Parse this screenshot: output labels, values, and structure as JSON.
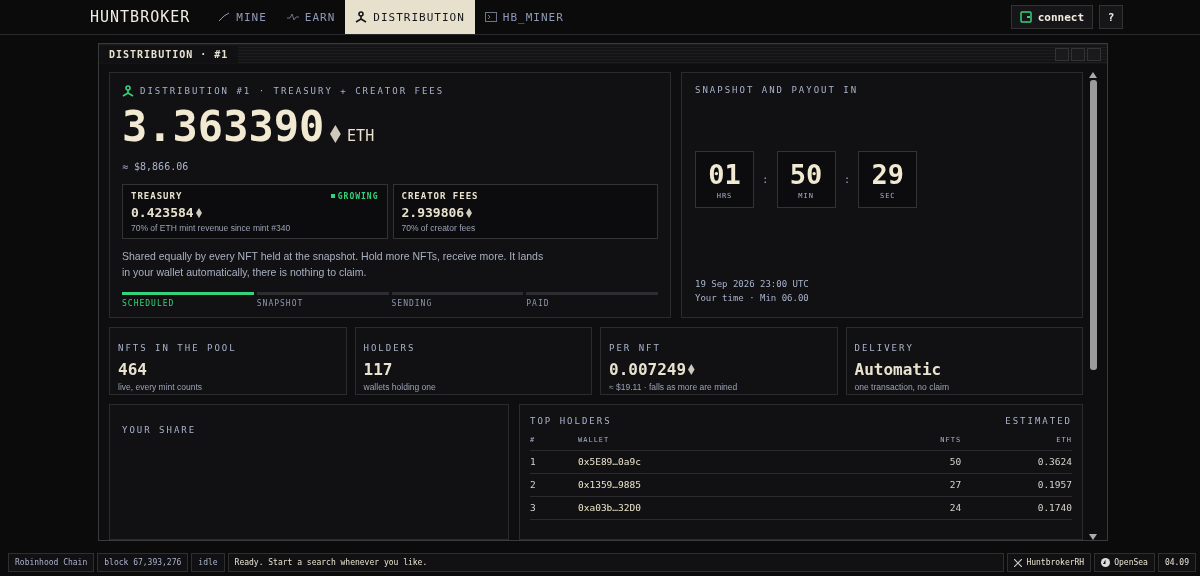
{
  "app": {
    "brand": "HUNTBROKER",
    "tabs": [
      {
        "label": "MINE",
        "selected": false
      },
      {
        "label": "EARN",
        "selected": false
      },
      {
        "label": "DISTRIBUTION",
        "selected": true
      },
      {
        "label": "HB_MINER",
        "selected": false
      }
    ],
    "connect": "connect",
    "help": "?"
  },
  "window": {
    "title": "DISTRIBUTION · #1"
  },
  "pool": {
    "heading": "DISTRIBUTION #1 · TREASURY + CREATOR FEES",
    "amount": "3.363390",
    "unit": "ETH",
    "usd": "≈ $8,866.06",
    "sources": [
      {
        "title": "TREASURY",
        "badge": "GROWING",
        "value": "0.423584",
        "note": "70% of ETH mint revenue since mint #340"
      },
      {
        "title": "CREATOR FEES",
        "value": "2.939806",
        "note": "70% of creator fees"
      }
    ],
    "description": "Shared equally by every NFT held at the snapshot. Hold more NFTs, receive more. It lands in your wallet automatically, there is nothing to claim.",
    "steps": [
      {
        "label": "SCHEDULED",
        "selected": true
      },
      {
        "label": "SNAPSHOT",
        "selected": false
      },
      {
        "label": "SENDING",
        "selected": false
      },
      {
        "label": "PAID",
        "selected": false
      }
    ]
  },
  "countdown": {
    "heading": "SNAPSHOT AND PAYOUT IN",
    "units": [
      {
        "value": "01",
        "label": "HRS"
      },
      {
        "value": "50",
        "label": "MIN"
      },
      {
        "value": "29",
        "label": "SEC"
      }
    ],
    "separators": [
      ":",
      ":"
    ],
    "date": "19 Sep 2026 23:00 UTC",
    "local": "Your time · Min 06.00"
  },
  "stats": [
    {
      "title": "NFTS IN THE POOL",
      "value": "464",
      "note": "live, every mint counts",
      "kind": "count"
    },
    {
      "title": "HOLDERS",
      "value": "117",
      "note": "wallets holding one",
      "kind": "count"
    },
    {
      "title": "PER NFT",
      "value": "0.007249",
      "note": "≈ $19.11 · falls as more are mined",
      "kind": "eth"
    },
    {
      "title": "DELIVERY",
      "value": "Automatic",
      "note": "one transaction, no claim",
      "kind": "text"
    }
  ],
  "your_share": {
    "heading": "YOUR SHARE"
  },
  "top_holders": {
    "heading": "TOP HOLDERS",
    "side": "ESTIMATED",
    "columns": [
      "#",
      "WALLET",
      "NFTS",
      "ETH"
    ],
    "rows": [
      [
        "1",
        "0x5E89…0a9c",
        "50",
        "0.3624"
      ],
      [
        "2",
        "0x1359…9885",
        "27",
        "0.1957"
      ],
      [
        "3",
        "0xa03b…32D0",
        "24",
        "0.1740"
      ]
    ]
  },
  "status_bar": {
    "chain": "Robinhood Chain",
    "block": "block 67,393,276",
    "state": "idle",
    "message": "Ready. Start a search whenever you like.",
    "x_link": "HuntbrokerRH",
    "opensea": "OpenSea",
    "time": "04.09"
  }
}
